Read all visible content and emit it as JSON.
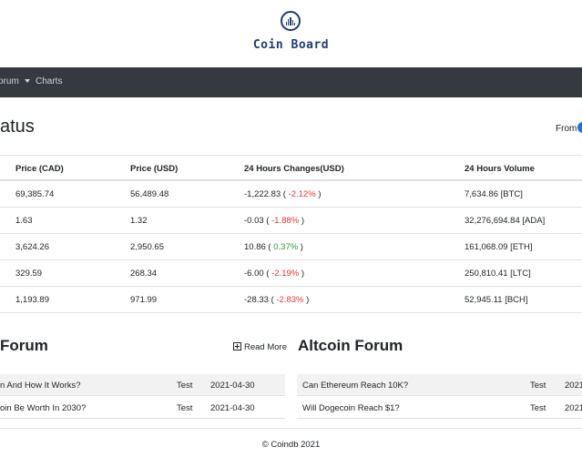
{
  "brand": {
    "logo_icon": "bar-chart-circle-icon",
    "name": "Coin Board"
  },
  "nav": {
    "forum_label": "Forum",
    "forum_partial": "orum",
    "charts_label": "Charts"
  },
  "status": {
    "title_partial": "atus",
    "from_label": "From"
  },
  "table": {
    "headers": [
      "Price (CAD)",
      "Price (USD)",
      "24 Hours Changes(USD)",
      "24 Hours Volume"
    ],
    "rows": [
      {
        "cad": "69,385.74",
        "usd": "56,489.48",
        "change": "-1,222.83",
        "pct": "-2.12%",
        "pct_dir": "neg",
        "volume": "7,634.86 [BTC]"
      },
      {
        "cad": "1.63",
        "usd": "1.32",
        "change": "-0.03",
        "pct": "-1.88%",
        "pct_dir": "neg",
        "volume": "32,276,694.84 [ADA]"
      },
      {
        "cad": "3,624.26",
        "usd": "2,950.65",
        "change": "10.86",
        "pct": "0.37%",
        "pct_dir": "pos",
        "volume": "161,068.09 [ETH]"
      },
      {
        "cad": "329.59",
        "usd": "268.34",
        "change": "-6.00",
        "pct": "-2.19%",
        "pct_dir": "neg",
        "volume": "250,810.41 [LTC]"
      },
      {
        "cad": "1,193.89",
        "usd": "971.99",
        "change": "-28.33",
        "pct": "-2.83%",
        "pct_dir": "neg",
        "volume": "52,945.11 [BCH]"
      }
    ]
  },
  "left_forum": {
    "title_partial": "Forum",
    "read_more": "Read More",
    "posts": [
      {
        "title_partial": "n And How It Works?",
        "author": "Test",
        "date": "2021-04-30"
      },
      {
        "title_partial": "oin Be Worth In 2030?",
        "author": "Test",
        "date": "2021-04-30"
      }
    ]
  },
  "altcoin_forum": {
    "title": "Altcoin Forum",
    "posts": [
      {
        "title": "Can Ethereum Reach 10K?",
        "author": "Test",
        "date_partial": "2021"
      },
      {
        "title": "Will Dogecoin Reach $1?",
        "author": "Test",
        "date_partial": "2021"
      }
    ]
  },
  "footer": {
    "text": "© Coindb 2021"
  },
  "colors": {
    "brand": "#1f3b73",
    "navbar": "#343a40",
    "negative": "#e53935",
    "positive": "#2e9d38",
    "toggle": "#1a73e8"
  }
}
